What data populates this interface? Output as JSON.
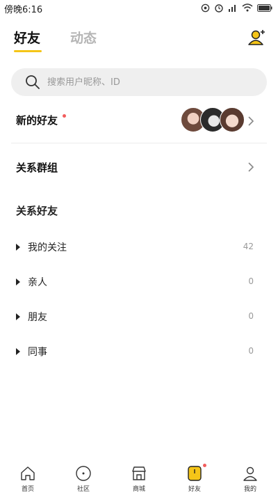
{
  "status_bar": {
    "time": "傍晚6:16"
  },
  "tabs": [
    {
      "label": "好友"
    },
    {
      "label": "动态"
    }
  ],
  "search": {
    "placeholder": "搜索用户昵称、ID"
  },
  "new_friends": {
    "label": "新的好友"
  },
  "groups": {
    "label": "关系群组"
  },
  "relations": {
    "title": "关系好友",
    "items": [
      {
        "label": "我的关注",
        "count": "42"
      },
      {
        "label": "亲人",
        "count": "0"
      },
      {
        "label": "朋友",
        "count": "0"
      },
      {
        "label": "同事",
        "count": "0"
      }
    ]
  },
  "bottom_nav": [
    {
      "label": "首页",
      "icon": "home-icon"
    },
    {
      "label": "社区",
      "icon": "community-icon"
    },
    {
      "label": "商城",
      "icon": "store-icon"
    },
    {
      "label": "好友",
      "icon": "friends-icon"
    },
    {
      "label": "我的",
      "icon": "person-icon"
    }
  ],
  "colors": {
    "accent": "#f5c518",
    "badge": "#f25d5d",
    "muted": "#b5b5b5"
  }
}
